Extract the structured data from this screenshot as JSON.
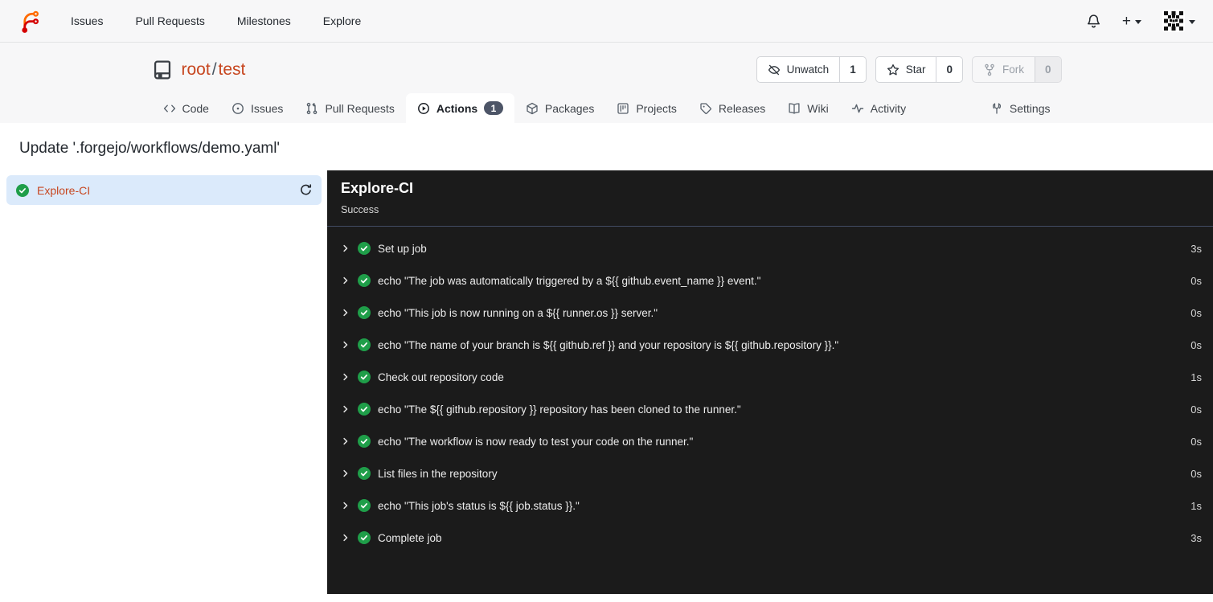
{
  "navbar": {
    "items": [
      {
        "label": "Issues"
      },
      {
        "label": "Pull Requests"
      },
      {
        "label": "Milestones"
      },
      {
        "label": "Explore"
      }
    ],
    "plus_label": "+"
  },
  "repo_header": {
    "owner": "root",
    "separator": "/",
    "name": "test",
    "buttons": [
      {
        "label": "Unwatch",
        "count": "1",
        "icon": "eye-slash-icon",
        "disabled": false
      },
      {
        "label": "Star",
        "count": "0",
        "icon": "star-icon",
        "disabled": false
      },
      {
        "label": "Fork",
        "count": "0",
        "icon": "fork-icon",
        "disabled": true
      }
    ]
  },
  "tabs": {
    "items": [
      {
        "label": "Code"
      },
      {
        "label": "Issues"
      },
      {
        "label": "Pull Requests"
      },
      {
        "label": "Actions",
        "badge": "1",
        "active": true
      },
      {
        "label": "Packages"
      },
      {
        "label": "Projects"
      },
      {
        "label": "Releases"
      },
      {
        "label": "Wiki"
      },
      {
        "label": "Activity"
      }
    ],
    "right_item": {
      "label": "Settings"
    }
  },
  "page": {
    "title": "Update '.forgejo/workflows/demo.yaml'"
  },
  "sidebar": {
    "job": {
      "name": "Explore-CI",
      "status": "success"
    }
  },
  "panel": {
    "title": "Explore-CI",
    "status": "Success",
    "steps": [
      {
        "name": "Set up job",
        "duration": "3s"
      },
      {
        "name": "echo \"The job was automatically triggered by a ${{ github.event_name }} event.\"",
        "duration": "0s"
      },
      {
        "name": "echo \"This job is now running on a ${{ runner.os }} server.\"",
        "duration": "0s"
      },
      {
        "name": "echo \"The name of your branch is ${{ github.ref }} and your repository is ${{ github.repository }}.\"",
        "duration": "0s"
      },
      {
        "name": "Check out repository code",
        "duration": "1s"
      },
      {
        "name": "echo \"The ${{ github.repository }} repository has been cloned to the runner.\"",
        "duration": "0s"
      },
      {
        "name": "echo \"The workflow is now ready to test your code on the runner.\"",
        "duration": "0s"
      },
      {
        "name": "List files in the repository",
        "duration": "0s"
      },
      {
        "name": "echo \"This job's status is ${{ job.status }}.\"",
        "duration": "1s"
      },
      {
        "name": "Complete job",
        "duration": "3s"
      }
    ]
  },
  "icons": {
    "forgejo-logo": "orange-red branch glyph",
    "bell-icon": "notifications bell",
    "plus-icon": "+",
    "caret-down-icon": "▾",
    "avatar": "black and white identicon",
    "repo-icon": "book with bookmark",
    "eye-slash-icon": "unwatch eye",
    "star-icon": "star outline",
    "fork-icon": "git fork",
    "code-icon": "angle brackets",
    "issue-icon": "circled dot",
    "pull-request-icon": "git pull request",
    "play-circle-icon": "circled play",
    "package-icon": "3d box",
    "project-icon": "project board",
    "tag-icon": "release tag",
    "book-icon": "open book wiki",
    "pulse-icon": "activity pulse line",
    "tools-icon": "settings tools",
    "check-circle-icon": "green success check",
    "chevron-right-icon": "expand chevron",
    "refresh-icon": "re-run circular arrow"
  },
  "colors": {
    "accent_link": "#c7461f",
    "header_bg": "#f7f7f8",
    "selected_job_bg": "#dbeafb",
    "panel_bg": "#1b1b1b",
    "success_green": "#1f9e49",
    "badge_bg": "#4d5567"
  }
}
